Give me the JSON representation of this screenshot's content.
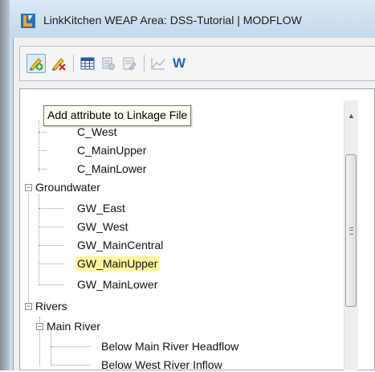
{
  "window": {
    "title": "LinkKitchen   WEAP Area: DSS-Tutorial | MODFLOW"
  },
  "toolbar": {
    "buttons": [
      {
        "icon": "add-attribute-icon",
        "active": true
      },
      {
        "icon": "remove-attribute-icon",
        "active": false
      },
      {
        "icon": "grid-icon",
        "active": false
      },
      {
        "icon": "linkage-icon",
        "active": false
      },
      {
        "icon": "edit-icon",
        "active": false
      },
      {
        "icon": "chart-icon",
        "active": false
      },
      {
        "icon": "weap-w-icon",
        "active": false,
        "glyph": "W"
      }
    ]
  },
  "tooltip": {
    "text": "Add attribute to Linkage File"
  },
  "tree": {
    "catchment_items": [
      "C_West",
      "C_MainUpper",
      "C_MainLower"
    ],
    "groundwater": {
      "label": "Groundwater",
      "expander": "−",
      "items": [
        "GW_East",
        "GW_West",
        "GW_MainCentral",
        "GW_MainUpper",
        "GW_MainLower"
      ],
      "selected": "GW_MainUpper"
    },
    "rivers": {
      "label": "Rivers",
      "expander": "−",
      "main_river": {
        "label": "Main River",
        "expander": "−",
        "items": [
          "Below Main River Headflow",
          "Below West River Inflow"
        ]
      }
    }
  },
  "scrollbar": {
    "up_glyph": "▲"
  },
  "colors": {
    "highlight": "#fff59a",
    "titlebar": "#c9dcef"
  }
}
